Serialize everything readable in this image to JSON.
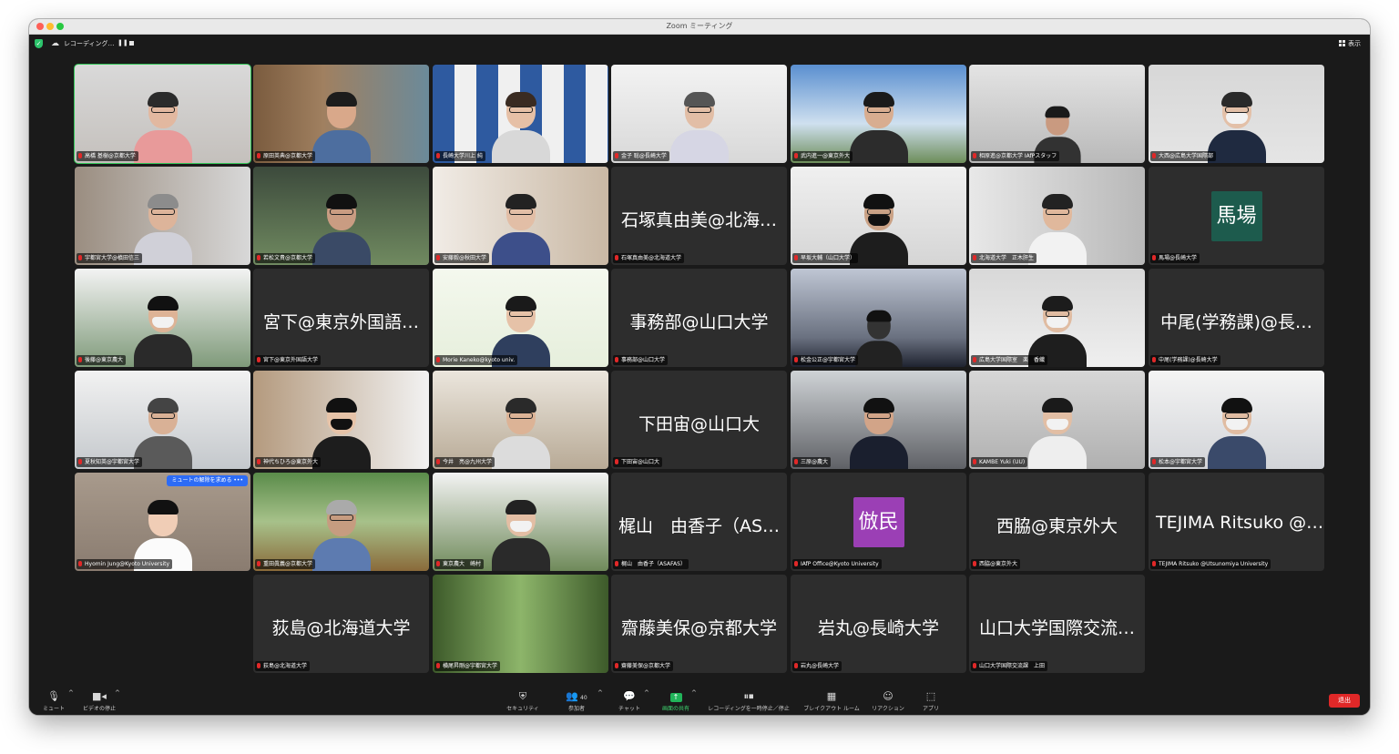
{
  "window": {
    "title": "Zoom ミーティング"
  },
  "topbar": {
    "recording_label": "レコーディング…",
    "pause_glyph": "❚❚",
    "view_label": "表示"
  },
  "tiles": [
    {
      "name": "高橋 基樹@京都大学",
      "display": "",
      "avatar_text": "",
      "active": true
    },
    {
      "name": "原田英典@京都大学",
      "display": "",
      "avatar_text": ""
    },
    {
      "name": "長崎大学川上 純",
      "display": "",
      "avatar_text": ""
    },
    {
      "name": "金子 聡@長崎大学",
      "display": "",
      "avatar_text": ""
    },
    {
      "name": "武内進一@東京外大",
      "display": "",
      "avatar_text": ""
    },
    {
      "name": "相原進@京都大学 IAfPスタッフ",
      "display": "",
      "avatar_text": ""
    },
    {
      "name": "大西@広島大学国際部",
      "display": "",
      "avatar_text": ""
    },
    {
      "name": "宇都宮大学@槙田信三",
      "display": "",
      "avatar_text": ""
    },
    {
      "name": "若松文貴@京都大学",
      "display": "",
      "avatar_text": ""
    },
    {
      "name": "安藤毅@秋田大学",
      "display": "",
      "avatar_text": ""
    },
    {
      "name": "石塚真由美@北海道大学",
      "display": "石塚真由美@北海…",
      "avatar_text": ""
    },
    {
      "name": "早坂大輔（山口大学）",
      "display": "",
      "avatar_text": ""
    },
    {
      "name": "北海道大学　正木肝生",
      "display": "",
      "avatar_text": ""
    },
    {
      "name": "馬場@長崎大学",
      "display": "",
      "avatar_text": "馬場",
      "avatar_color": "#1d5b4d"
    },
    {
      "name": "後藤@東京農大",
      "display": "",
      "avatar_text": ""
    },
    {
      "name": "宮下@東京外国語大学",
      "display": "宮下@東京外国語…",
      "avatar_text": ""
    },
    {
      "name": "Morie Kaneko@kyoto univ.",
      "display": "",
      "avatar_text": ""
    },
    {
      "name": "事務部@山口大学",
      "display": "事務部@山口大学",
      "avatar_text": ""
    },
    {
      "name": "松金公正@宇都宮大学",
      "display": "",
      "avatar_text": ""
    },
    {
      "name": "広島大学国際室　楽　香織",
      "display": "",
      "avatar_text": ""
    },
    {
      "name": "中尾(学務課)@長崎大学",
      "display": "中尾(学務課)@長…",
      "avatar_text": ""
    },
    {
      "name": "夏秋知英@宇都宮大学",
      "display": "",
      "avatar_text": ""
    },
    {
      "name": "神代ちひろ@東京外大",
      "display": "",
      "avatar_text": ""
    },
    {
      "name": "今井　亮@九州大学",
      "display": "",
      "avatar_text": ""
    },
    {
      "name": "下田宙@山口大",
      "display": "下田宙@山口大",
      "avatar_text": ""
    },
    {
      "name": "三原@農大",
      "display": "",
      "avatar_text": ""
    },
    {
      "name": "KAMBE Yuki (UU)",
      "display": "",
      "avatar_text": ""
    },
    {
      "name": "松本@宇都宮大学",
      "display": "",
      "avatar_text": ""
    },
    {
      "name": "Hyomin Jung@Kyoto University",
      "display": "",
      "avatar_text": "",
      "badge": "ミュートの解除を求める",
      "badge_more": "•••"
    },
    {
      "name": "重田眞義@京都大学",
      "display": "",
      "avatar_text": ""
    },
    {
      "name": "東京農大　崎村",
      "display": "",
      "avatar_text": ""
    },
    {
      "name": "梶山　由香子（ASAFAS）",
      "display": "梶山　由香子（AS…",
      "avatar_text": ""
    },
    {
      "name": "IAfP Office@Kyoto University",
      "display": "",
      "avatar_text": "倣民",
      "avatar_color": "#9b3fb5"
    },
    {
      "name": "西脇@東京外大",
      "display": "西脇@東京外大",
      "avatar_text": ""
    },
    {
      "name": "TEJIMA Ritsuko @Utsunomiya University",
      "display": "TEJIMA Ritsuko @…",
      "avatar_text": ""
    },
    {
      "name": "荻島@北海道大学",
      "display": "荻島@北海道大学",
      "avatar_text": ""
    },
    {
      "name": "横尾昇剛@宇都宮大学",
      "display": "",
      "avatar_text": ""
    },
    {
      "name": "齋藤美保@京都大学",
      "display": "齋藤美保@京都大学",
      "avatar_text": ""
    },
    {
      "name": "岩丸@長崎大学",
      "display": "岩丸@長崎大学",
      "avatar_text": ""
    },
    {
      "name": "山口大学国際交流課　上田",
      "display": "山口大学国際交流…",
      "avatar_text": ""
    }
  ],
  "toolbar": {
    "mute": "ミュート",
    "video": "ビデオの停止",
    "security": "セキュリティ",
    "participants": "参加者",
    "participants_count": "40",
    "chat": "チャット",
    "share": "画面の共有",
    "recording": "レコーディングを一時停止／停止",
    "breakout": "ブレイクアウト ルーム",
    "reactions": "リアクション",
    "apps": "アプリ",
    "leave": "退出"
  },
  "colors": {
    "active_border": "#34c759",
    "leave": "#e02828",
    "share_green": "#21b45a",
    "unmute_badge": "#2d6cf6",
    "tile_bg": "#2d2d2d"
  }
}
